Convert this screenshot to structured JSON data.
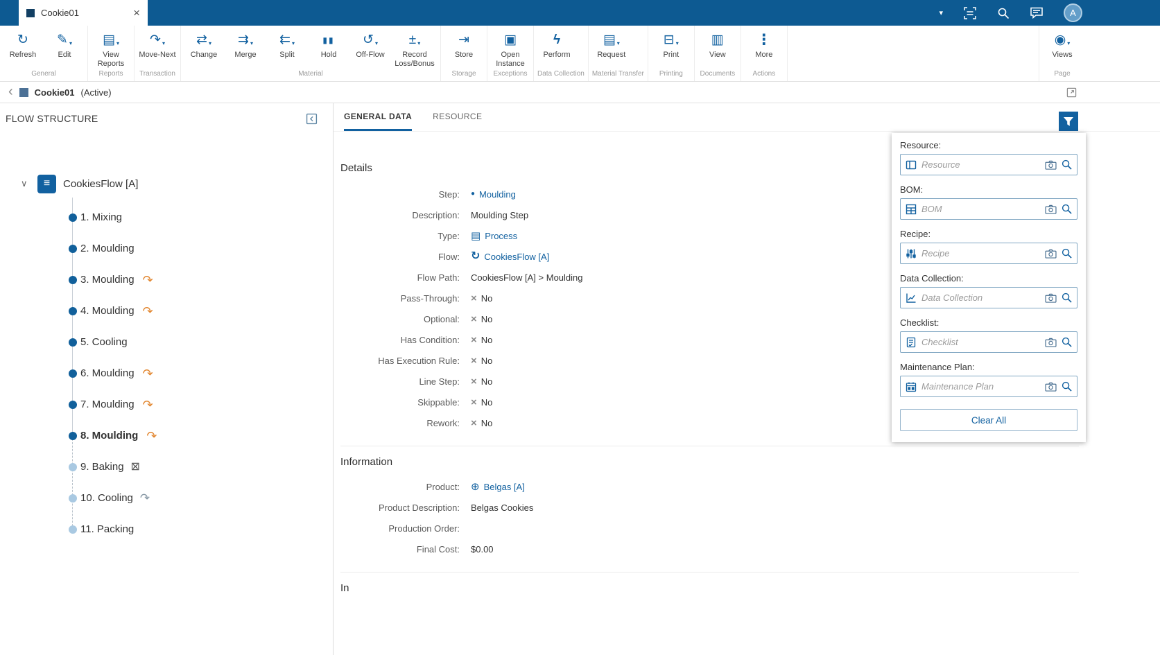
{
  "icons": {
    "caret": "▾",
    "close": "×",
    "back_chevron": "‹",
    "tree_chevron": "∨",
    "root_flow": "≡",
    "refresh": "↻",
    "edit": "✎",
    "view_reports": "▤",
    "move_next": "↷",
    "change": "⇄",
    "merge": "⇉",
    "split": "⇇",
    "hold": "▮▮",
    "off_flow": "↺",
    "record_loss_bonus": "±",
    "store": "⇥",
    "open_instance": "▣",
    "perform": "ϟ",
    "request": "▤",
    "print": "⊟",
    "view_documents": "▥",
    "more": "⋮",
    "views": "◉",
    "no_x": "×",
    "step_dot": "●",
    "process": "▤",
    "flow": "↻",
    "product": "⊕",
    "rework_arrow": "↷",
    "baking_badge": "⊠",
    "sampling_badge": "↷"
  },
  "topbar": {
    "tab_title": "Cookie01",
    "avatar_initial": "A"
  },
  "toolbar": {
    "groups": [
      {
        "label": "General",
        "buttons": [
          {
            "label": "Refresh"
          },
          {
            "label": "Edit"
          }
        ]
      },
      {
        "label": "Reports",
        "buttons": [
          {
            "label": "View Reports"
          }
        ]
      },
      {
        "label": "Transaction",
        "buttons": [
          {
            "label": "Move-Next"
          }
        ]
      },
      {
        "label": "Material",
        "buttons": [
          {
            "label": "Change"
          },
          {
            "label": "Merge"
          },
          {
            "label": "Split"
          },
          {
            "label": "Hold"
          },
          {
            "label": "Off-Flow"
          },
          {
            "label": "Record Loss/Bonus"
          }
        ]
      },
      {
        "label": "Storage",
        "buttons": [
          {
            "label": "Store"
          }
        ]
      },
      {
        "label": "Exceptions",
        "buttons": [
          {
            "label": "Open Instance"
          }
        ]
      },
      {
        "label": "Data Collection",
        "buttons": [
          {
            "label": "Perform"
          }
        ]
      },
      {
        "label": "Material Transfer",
        "buttons": [
          {
            "label": "Request"
          }
        ]
      },
      {
        "label": "Printing",
        "buttons": [
          {
            "label": "Print"
          }
        ]
      },
      {
        "label": "Documents",
        "buttons": [
          {
            "label": "View"
          }
        ]
      },
      {
        "label": "Actions",
        "buttons": [
          {
            "label": "More"
          }
        ]
      },
      {
        "label": "Page",
        "buttons": [
          {
            "label": "Views"
          }
        ]
      }
    ]
  },
  "breadcrumb": {
    "title": "Cookie01",
    "status": "(Active)"
  },
  "flow_panel": {
    "title": "FLOW STRUCTURE",
    "root_label": "CookiesFlow [A]",
    "steps": [
      {
        "label": "1. Mixing"
      },
      {
        "label": "2. Moulding"
      },
      {
        "label": "3. Moulding"
      },
      {
        "label": "4. Moulding"
      },
      {
        "label": "5. Cooling"
      },
      {
        "label": "6. Moulding"
      },
      {
        "label": "7. Moulding"
      },
      {
        "label": "8. Moulding"
      },
      {
        "label": "9. Baking"
      },
      {
        "label": "10. Cooling"
      },
      {
        "label": "11. Packing"
      }
    ]
  },
  "main": {
    "tabs": [
      {
        "label": "GENERAL DATA"
      },
      {
        "label": "RESOURCE"
      }
    ],
    "details": {
      "title": "Details",
      "rows": [
        {
          "label": "Step:",
          "value": "Moulding"
        },
        {
          "label": "Description:",
          "value": "Moulding Step"
        },
        {
          "label": "Type:",
          "value": "Process"
        },
        {
          "label": "Flow:",
          "value": "CookiesFlow [A]"
        },
        {
          "label": "Flow Path:",
          "value": "CookiesFlow [A] > Moulding"
        },
        {
          "label": "Pass-Through:",
          "value": "No"
        },
        {
          "label": "Optional:",
          "value": "No"
        },
        {
          "label": "Has Condition:",
          "value": "No"
        },
        {
          "label": "Has Execution Rule:",
          "value": "No"
        },
        {
          "label": "Line Step:",
          "value": "No"
        },
        {
          "label": "Skippable:",
          "value": "No"
        },
        {
          "label": "Rework:",
          "value": "No"
        }
      ]
    },
    "information": {
      "title": "Information",
      "rows": [
        {
          "label": "Product:",
          "value": "Belgas [A]"
        },
        {
          "label": "Product Description:",
          "value": "Belgas Cookies"
        },
        {
          "label": "Production Order:",
          "value": ""
        },
        {
          "label": "Final Cost:",
          "value": "$0.00"
        }
      ]
    },
    "in_section": {
      "title": "In"
    }
  },
  "filter_panel": {
    "fields": [
      {
        "label": "Resource:",
        "placeholder": "Resource"
      },
      {
        "label": "BOM:",
        "placeholder": "BOM"
      },
      {
        "label": "Recipe:",
        "placeholder": "Recipe"
      },
      {
        "label": "Data Collection:",
        "placeholder": "Data Collection"
      },
      {
        "label": "Checklist:",
        "placeholder": "Checklist"
      },
      {
        "label": "Maintenance Plan:",
        "placeholder": "Maintenance Plan"
      }
    ],
    "clear_all_label": "Clear All"
  }
}
